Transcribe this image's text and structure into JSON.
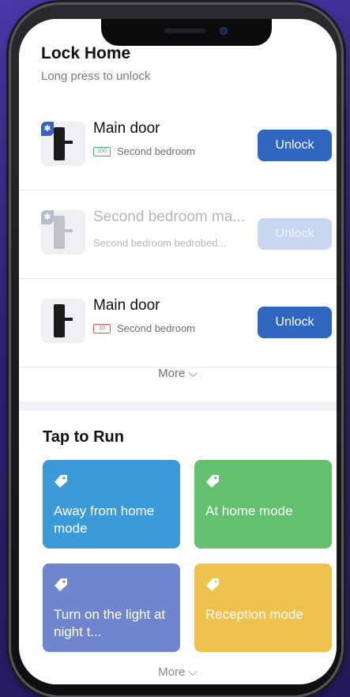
{
  "lock_section": {
    "title": "Lock Home",
    "subtitle": "Long press to unlock",
    "locks": [
      {
        "name": "Main door",
        "room": "Second bedroom",
        "battery": "100",
        "button": "Unlock"
      },
      {
        "name": "Second bedroom ma...",
        "room": "Second bedroom bedrobed...",
        "battery": "",
        "button": "Unlock"
      },
      {
        "name": "Main door",
        "room": "Second bedroom",
        "battery": "10",
        "button": "Unlock"
      }
    ],
    "more": "More"
  },
  "scenes": {
    "title": "Tap to Run",
    "tiles": [
      {
        "label": "Away from home mode",
        "color": "#3d9ad8",
        "icon": "tag-icon"
      },
      {
        "label": "At home mode",
        "color": "#63c06f",
        "icon": "tag-icon"
      },
      {
        "label": "Turn on the light at night t...",
        "color": "#6f86cf",
        "icon": "tag-icon"
      },
      {
        "label": "Reception mode",
        "color": "#efc24d",
        "icon": "tag-icon"
      }
    ],
    "more": "More"
  },
  "colors": {
    "accent": "#3066bf",
    "background": "#3a2a8a"
  }
}
